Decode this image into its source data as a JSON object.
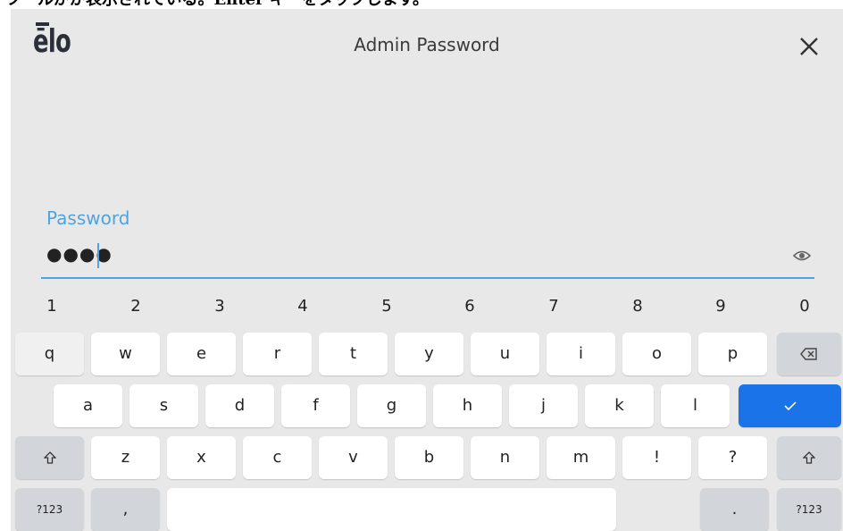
{
  "caption": "ツ一ルがが表示されている。Enter キーをタップします。",
  "header": {
    "logo": "ēlo",
    "title": "Admin Password"
  },
  "field": {
    "label": "Password",
    "value": "●●●●"
  },
  "number_row": [
    "1",
    "2",
    "3",
    "4",
    "5",
    "6",
    "7",
    "8",
    "9",
    "0"
  ],
  "row1": [
    "q",
    "w",
    "e",
    "r",
    "t",
    "y",
    "u",
    "i",
    "o",
    "p"
  ],
  "row2": [
    "a",
    "s",
    "d",
    "f",
    "g",
    "h",
    "j",
    "k",
    "l"
  ],
  "row3": [
    "z",
    "x",
    "c",
    "v",
    "b",
    "n",
    "m",
    "!",
    "?"
  ],
  "bottom": {
    "sym_left": "?123",
    "comma": ",",
    "period": ".",
    "sym_right": "?123"
  },
  "icons": {
    "close": "close-icon",
    "visibility": "eye-icon",
    "backspace": "backspace-icon",
    "enter": "checkmark-icon",
    "shift": "shift-icon"
  },
  "colors": {
    "accent": "#4ea3e0",
    "enter_key": "#1a73e8",
    "background": "#e8e8e8"
  }
}
